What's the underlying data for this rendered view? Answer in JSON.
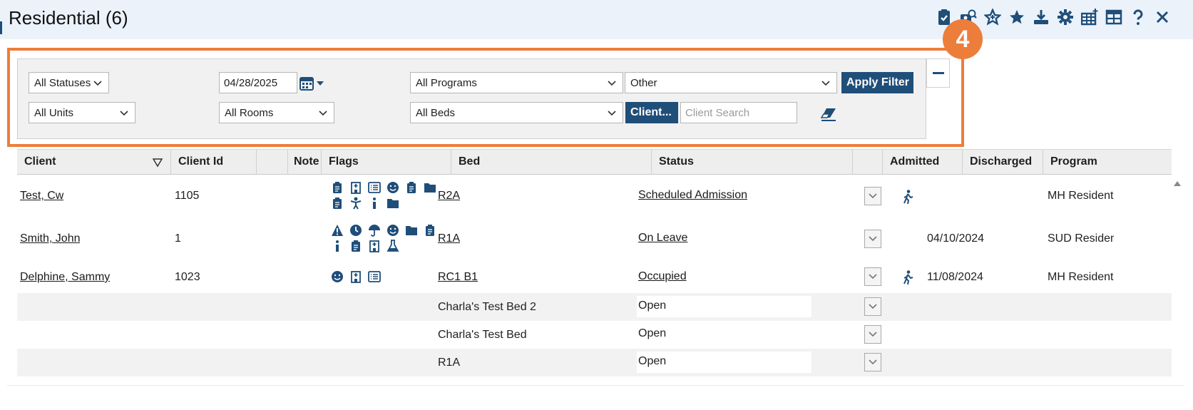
{
  "header": {
    "title": "Residential (6)",
    "toolbar_icons": [
      "clipboard-check-icon",
      "client-search-icon",
      "star-outline-icon",
      "star-icon",
      "download-icon",
      "gear-icon",
      "table-add-icon",
      "table-icon",
      "help-icon",
      "close-icon"
    ]
  },
  "callout": {
    "number": "4",
    "color": "#ed7d3a"
  },
  "filters": {
    "status": "All Statuses",
    "date": "04/28/2025",
    "program": "All Programs",
    "other": "Other",
    "apply_label": "Apply Filter",
    "unit": "All Units",
    "room": "All Rooms",
    "bed": "All Beds",
    "client_button": "Client...",
    "client_search_placeholder": "Client Search"
  },
  "grid": {
    "columns": [
      "Client",
      "Client Id",
      "",
      "Note",
      "Flags",
      "Bed",
      "Status",
      "",
      "Admitted",
      "Discharged",
      "Program"
    ],
    "rows": [
      {
        "client": "Test, Cw",
        "client_id": "1105",
        "flags_line1": [
          "clipboard-icon",
          "hospital-icon",
          "list-icon",
          "smile-icon",
          "clipboard-icon",
          "folder-icon"
        ],
        "flags_line2": [
          "clipboard-icon",
          "person-icon",
          "info-icon",
          "folder-icon"
        ],
        "bed": "R2A",
        "status": "Scheduled Admission",
        "walk": true,
        "admitted": "",
        "discharged": "",
        "program": "MH Residential"
      },
      {
        "client": "Smith, John",
        "client_id": "1",
        "flags_line1": [
          "warning-icon",
          "clock-icon",
          "umbrella-icon",
          "smile-icon",
          "folder-icon",
          "clipboard-icon"
        ],
        "flags_line2": [
          "info-icon",
          "clipboard-icon",
          "hospital-icon",
          "flask-icon"
        ],
        "bed": "R1A",
        "status": "On Leave",
        "walk": false,
        "admitted": "04/10/2024",
        "discharged": "",
        "program": "SUD Residential"
      },
      {
        "client": "Delphine, Sammy",
        "client_id": "1023",
        "flags_line1": [
          "smile-icon",
          "hospital-icon",
          "list-icon"
        ],
        "flags_line2": [],
        "bed": "RC1 B1",
        "status": "Occupied",
        "walk": true,
        "admitted": "11/08/2024",
        "discharged": "",
        "program": "MH Residential"
      },
      {
        "client": "",
        "client_id": "",
        "flags_line1": [],
        "flags_line2": [],
        "bed": "Charla's Test Bed 2",
        "status": "Open",
        "walk": false,
        "admitted": "",
        "discharged": "",
        "program": ""
      },
      {
        "client": "",
        "client_id": "",
        "flags_line1": [],
        "flags_line2": [],
        "bed": "Charla's Test Bed",
        "status": "Open",
        "walk": false,
        "admitted": "",
        "discharged": "",
        "program": ""
      },
      {
        "client": "",
        "client_id": "",
        "flags_line1": [],
        "flags_line2": [],
        "bed": "R1A",
        "status": "Open",
        "walk": false,
        "admitted": "",
        "discharged": "",
        "program": ""
      }
    ]
  },
  "colors": {
    "brand": "#1f4e79",
    "accent": "#ed7d3a",
    "header_bg": "#ebf2fa"
  }
}
